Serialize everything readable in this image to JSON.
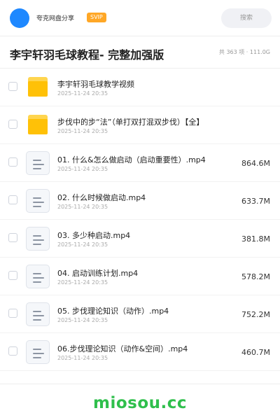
{
  "header": {
    "username": "夸克网盘分享",
    "badge": "SVIP",
    "search_label": "搜索",
    "accent_color": "#1e88ff"
  },
  "share": {
    "title": "李宇轩羽毛球教程- 完整加强版",
    "summary": "共 363 项 · 111.0G"
  },
  "files": [
    {
      "type": "folder",
      "name": "李宇轩羽毛球教学视频",
      "date": "2025-11-24 20:35",
      "size": ""
    },
    {
      "type": "folder",
      "name": "步伐中的步“法”（单打双打混双步伐）【全】",
      "date": "2025-11-24 20:35",
      "size": ""
    },
    {
      "type": "file",
      "name": "01. 什么&怎么做启动（启动重要性）.mp4",
      "date": "2025-11-24 20:35",
      "size": "864.6M"
    },
    {
      "type": "file",
      "name": "02. 什么时候做启动.mp4",
      "date": "2025-11-24 20:35",
      "size": "633.7M"
    },
    {
      "type": "file",
      "name": "03. 多少种启动.mp4",
      "date": "2025-11-24 20:35",
      "size": "381.8M"
    },
    {
      "type": "file",
      "name": "04. 启动训练计划.mp4",
      "date": "2025-11-24 20:35",
      "size": "578.2M"
    },
    {
      "type": "file",
      "name": "05. 步伐理论知识（动作）.mp4",
      "date": "2025-11-24 20:35",
      "size": "752.2M"
    },
    {
      "type": "file",
      "name": "06.步伐理论知识（动作&空间）.mp4",
      "date": "2025-11-24 20:35",
      "size": "460.7M"
    }
  ],
  "footer": {
    "brand": "miosou.cc",
    "brand_color": "#2fbf4c"
  }
}
